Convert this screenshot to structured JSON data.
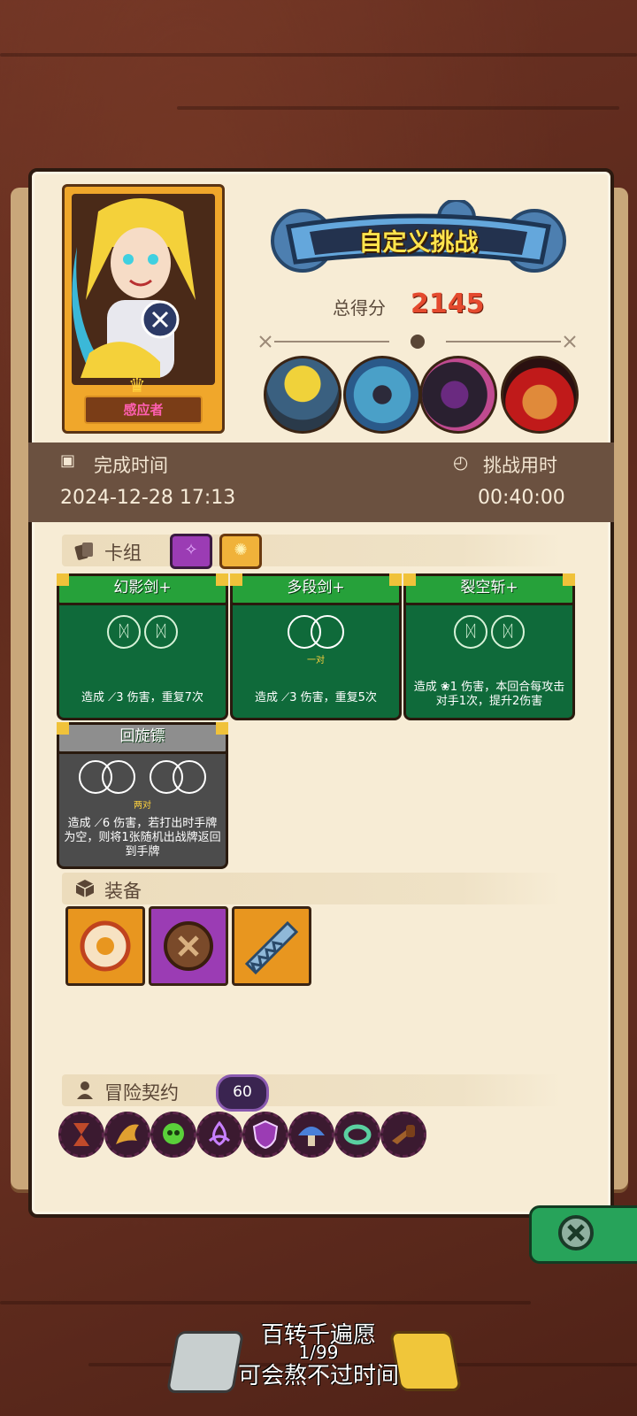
{
  "header": {
    "title": "自定义挑战",
    "score_label": "总得分",
    "score_value": "2145"
  },
  "character": {
    "name": "感应者"
  },
  "bosses": [
    {
      "name": "straw-hat-boss"
    },
    {
      "name": "crowned-golem-boss"
    },
    {
      "name": "shadow-beast-boss"
    },
    {
      "name": "clown-hat-boss"
    }
  ],
  "info": {
    "finish_time_label": "完成时间",
    "finish_time_value": "2024-12-28 17:13",
    "duration_label": "挑战用时",
    "duration_value": "00:40:00"
  },
  "deck": {
    "label": "卡组",
    "cards": [
      {
        "name": "幻影剑+",
        "desc": "造成 ⟋3 伤害，重复7次",
        "slots": "2 runes",
        "sub": ""
      },
      {
        "name": "多段剑+",
        "desc": "造成 ⟋3 伤害，重复5次",
        "slots": "pair",
        "sub": "一对"
      },
      {
        "name": "裂空斩+",
        "desc": "造成 ❀1 伤害，本回合每攻击对手1次，提升2伤害",
        "slots": "2 runes",
        "sub": ""
      },
      {
        "name": "回旋镖",
        "desc": "造成 ⟋6 伤害，若打出时手牌为空，则将1张随机出战牌返回到手牌",
        "slots": "two pairs",
        "sub": "两对"
      }
    ]
  },
  "equipment": {
    "label": "装备",
    "items": [
      {
        "icon": "round-token-icon",
        "color": "#e8961f"
      },
      {
        "icon": "button-icon",
        "color": "#9b3cb4"
      },
      {
        "icon": "saw-blade-icon",
        "color": "#e8961f"
      }
    ]
  },
  "contract": {
    "label": "冒险契约",
    "level": "60",
    "icons": [
      "hourglass-icon",
      "flame-wing-icon",
      "green-skull-icon",
      "triquetra-icon",
      "shield-icon",
      "mushroom-icon",
      "ring-icon",
      "pipe-icon"
    ]
  },
  "bottom": {
    "line1": "百转千遍愿",
    "page": "1/99",
    "line2": "可会熬不过时间"
  },
  "colors": {
    "accent_green": "#26a13a",
    "score_red": "#e44a2e",
    "title_yellow": "#ffe44d"
  }
}
